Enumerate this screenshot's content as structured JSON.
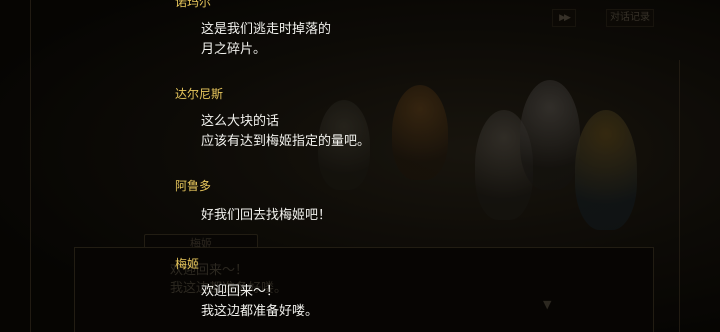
{
  "colors": {
    "speaker_name": "#e7c65c",
    "dialogue_text": "#f2f2ee",
    "background": "#0b0905"
  },
  "controls": {
    "fast_forward_icon": "fast-forward-icon",
    "fast_forward_label": "▶▶",
    "log_label": "对话记录"
  },
  "backlog": [
    {
      "speaker": "诺玛尔",
      "lines": [
        "这是我们逃走时掉落的",
        "月之碎片。"
      ]
    },
    {
      "speaker": "达尔尼斯",
      "lines": [
        "这么大块的话",
        "应该有达到梅姬指定的量吧。"
      ]
    },
    {
      "speaker": "阿鲁多",
      "lines": [
        "好我们回去找梅姬吧！"
      ]
    },
    {
      "speaker": "梅姬",
      "lines": [
        "欢迎回来～！",
        "我这边都准备好喽。"
      ]
    }
  ],
  "underlying_dialogue": {
    "name": "梅姬",
    "text": "欢迎回来～！\n我这边都准备好喽。",
    "next_indicator": "▼"
  }
}
